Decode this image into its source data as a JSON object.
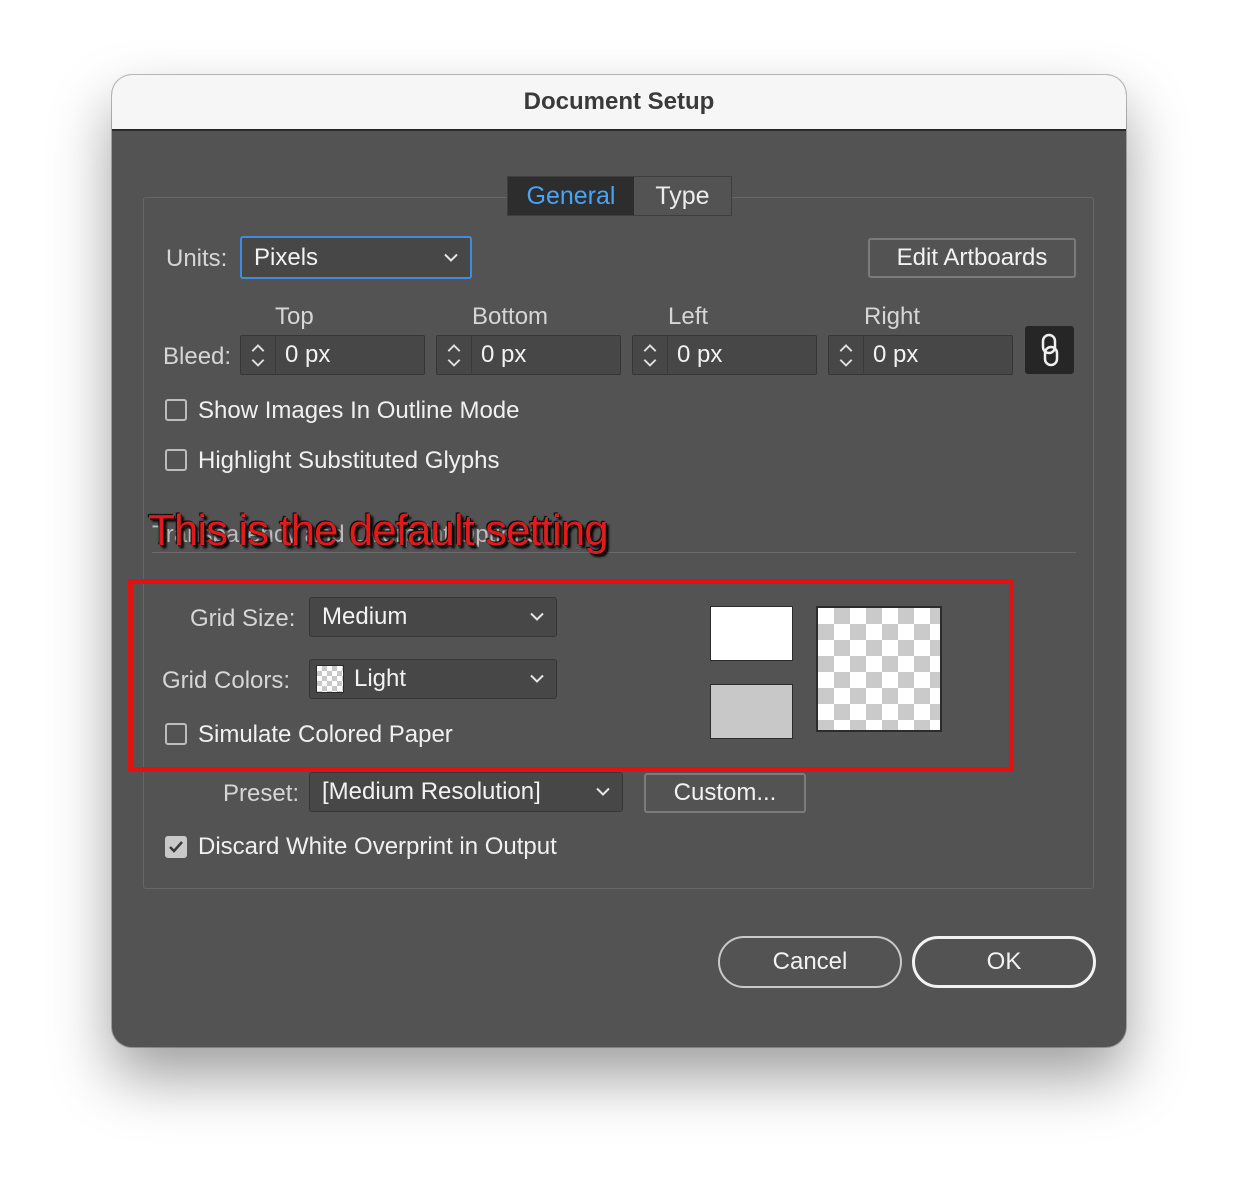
{
  "window": {
    "title": "Document Setup"
  },
  "tabs": [
    {
      "label": "General"
    },
    {
      "label": "Type"
    }
  ],
  "units": {
    "label": "Units:",
    "value": "Pixels"
  },
  "edit_artboards_label": "Edit Artboards",
  "bleed": {
    "label": "Bleed:",
    "fields": [
      {
        "header": "Top",
        "value": "0 px"
      },
      {
        "header": "Bottom",
        "value": "0 px"
      },
      {
        "header": "Left",
        "value": "0 px"
      },
      {
        "header": "Right",
        "value": "0 px"
      }
    ]
  },
  "checkboxes": {
    "show_images": {
      "label": "Show Images In Outline Mode",
      "checked": false
    },
    "highlight_glyphs": {
      "label": "Highlight Substituted Glyphs",
      "checked": false
    },
    "simulate_paper": {
      "label": "Simulate Colored Paper",
      "checked": false
    },
    "discard_overprint": {
      "label": "Discard White Overprint in Output",
      "checked": true
    }
  },
  "annotation": {
    "text": "This is the default setting",
    "color": "#e11b1b"
  },
  "obscured_section_text": "Transparency and Overprint Options",
  "grid_size": {
    "label": "Grid Size:",
    "value": "Medium"
  },
  "grid_colors": {
    "label": "Grid Colors:",
    "value": "Light"
  },
  "preset": {
    "label": "Preset:",
    "value": "[Medium Resolution]"
  },
  "custom_button_label": "Custom...",
  "buttons": {
    "cancel": "Cancel",
    "ok": "OK"
  },
  "colors": {
    "dialog_bg": "#535353",
    "accent": "#4aa3f0",
    "annotation_box": "#e21212"
  }
}
